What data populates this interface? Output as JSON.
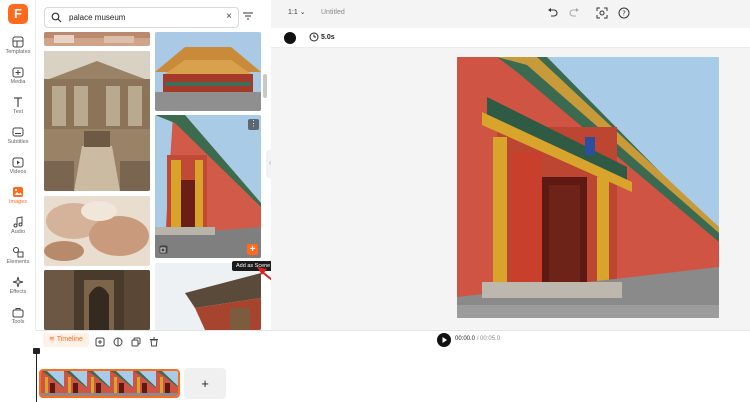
{
  "brand": {
    "logo_letter": "F",
    "accent": "#ff6a1f"
  },
  "sidebar": {
    "items": [
      {
        "label": "Templates",
        "icon": "templates-icon"
      },
      {
        "label": "Media",
        "icon": "media-icon"
      },
      {
        "label": "Text",
        "icon": "text-icon"
      },
      {
        "label": "Subtitles",
        "icon": "subtitles-icon"
      },
      {
        "label": "Videos",
        "icon": "videos-icon"
      },
      {
        "label": "Images",
        "icon": "images-icon",
        "active": true
      },
      {
        "label": "Audio",
        "icon": "audio-icon"
      },
      {
        "label": "Elements",
        "icon": "elements-icon"
      },
      {
        "label": "Effects",
        "icon": "effects-icon"
      },
      {
        "label": "Tools",
        "icon": "tools-icon"
      }
    ]
  },
  "search": {
    "value": "palace museum",
    "clear_glyph": "×"
  },
  "media_panel": {
    "tooltip": "Add as Scene",
    "more_glyph": "⋮",
    "add_glyph": "+"
  },
  "topbar": {
    "ratio": "1:1",
    "project_title": "Untitled"
  },
  "scene_bar": {
    "background_color": "#111111",
    "duration": "5.0s"
  },
  "timeline": {
    "tab_label": "Timeline",
    "current_time": "00:00.0",
    "separator": " / ",
    "total_time": "00:05.0",
    "add_glyph": "+"
  }
}
